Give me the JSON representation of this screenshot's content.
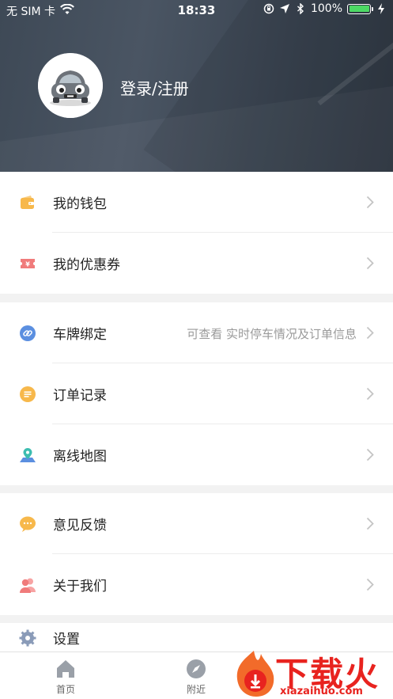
{
  "status_bar": {
    "carrier": "无 SIM 卡",
    "time": "18:33",
    "battery": "100%"
  },
  "profile": {
    "login_label": "登录/注册"
  },
  "menu": {
    "group1": [
      {
        "label": "我的钱包",
        "icon": "wallet-icon"
      },
      {
        "label": "我的优惠券",
        "icon": "coupon-icon"
      }
    ],
    "group2": [
      {
        "label": "车牌绑定",
        "icon": "link-icon",
        "hint": "可查看 实时停车情况及订单信息"
      },
      {
        "label": "订单记录",
        "icon": "order-list-icon"
      },
      {
        "label": "离线地图",
        "icon": "map-pin-icon"
      }
    ],
    "group3": [
      {
        "label": "意见反馈",
        "icon": "chat-bubble-icon"
      },
      {
        "label": "关于我们",
        "icon": "people-icon"
      }
    ],
    "group4": [
      {
        "label": "设置",
        "icon": "gear-icon"
      }
    ]
  },
  "tabbar": [
    {
      "label": "首页",
      "icon": "home-icon"
    },
    {
      "label": "附近",
      "icon": "compass-icon"
    }
  ],
  "watermark": {
    "title": "下载火",
    "url": "xiazaihuo.com"
  },
  "colors": {
    "header_bg": "#414c59",
    "wallet": "#f7b84b",
    "coupon": "#f07b7b",
    "link": "#5b8fe0",
    "order": "#f7b84b",
    "map": "#3dbdb0",
    "feedback": "#f7b84b",
    "about": "#f07b7b",
    "settings": "#8a9bb8",
    "watermark": "#e8231f"
  }
}
